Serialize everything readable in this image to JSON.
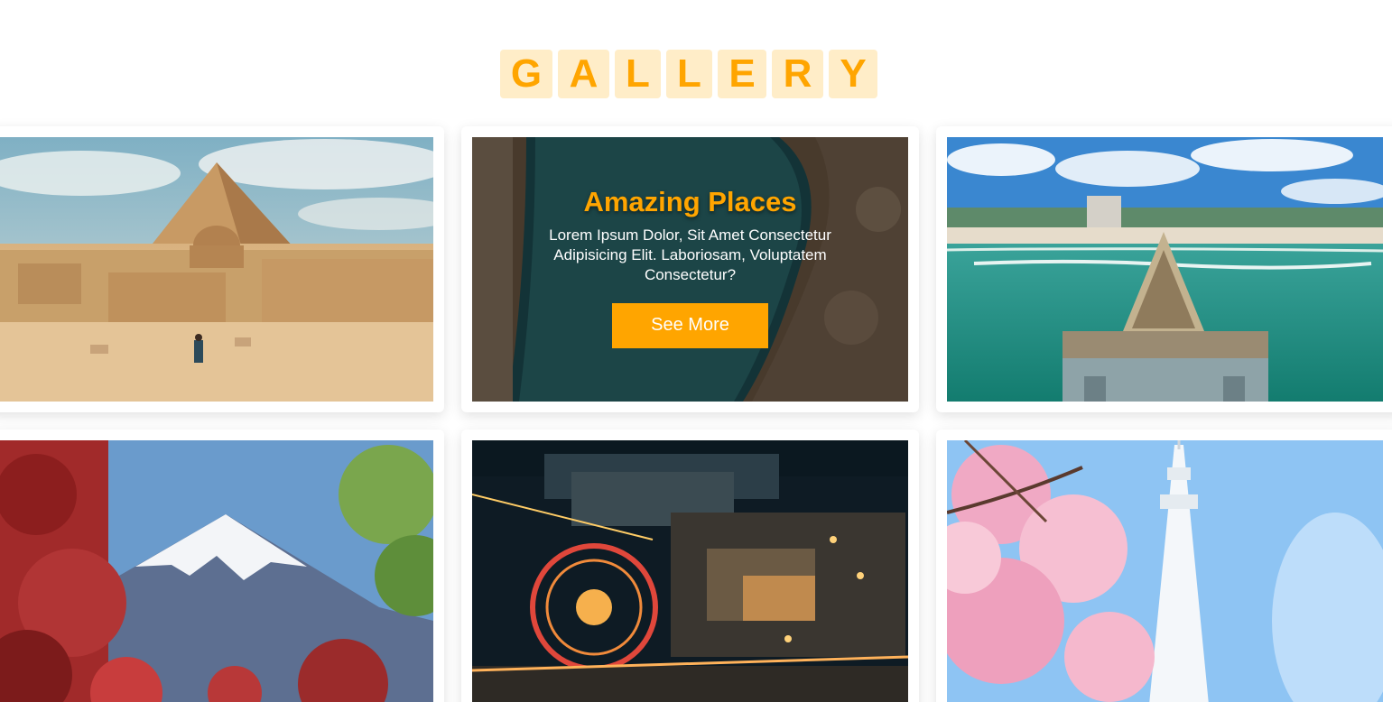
{
  "gallery": {
    "title_letters": [
      "G",
      "A",
      "L",
      "L",
      "E",
      "R",
      "Y"
    ]
  },
  "featured": {
    "title": "Amazing Places",
    "description": "Lorem Ipsum Dolor, Sit Amet Consectetur Adipisicing Elit. Laboriosam, Voluptatem Consectetur?",
    "button_label": "See More"
  },
  "colors": {
    "accent": "#ffa500",
    "title_bg": "#ffedc8"
  }
}
